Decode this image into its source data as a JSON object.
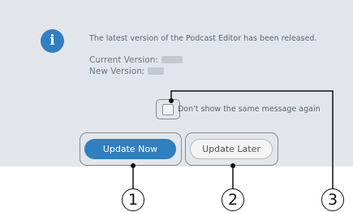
{
  "dialog": {
    "icon": "info-icon",
    "message": "The latest version of the Podcast Editor has been released.",
    "current_version_label": "Current Version:",
    "new_version_label": "New Version:",
    "checkbox_label": "Don't show the same message again",
    "checkbox_checked": false
  },
  "buttons": {
    "update_now": "Update Now",
    "update_later": "Update Later"
  },
  "callouts": [
    "1",
    "2",
    "3"
  ],
  "colors": {
    "dialog_bg": "#e2e6ea",
    "accent": "#2f7fc1"
  }
}
